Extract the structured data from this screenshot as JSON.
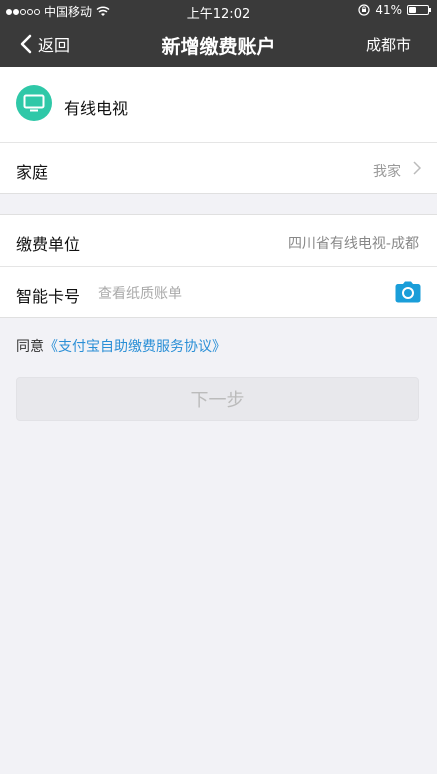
{
  "status_bar": {
    "carrier": "中国移动",
    "time": "上午12:02",
    "battery": "41%",
    "battery_level": 0.41
  },
  "nav": {
    "back_label": "返回",
    "title": "新增缴费账户",
    "city": "成都市"
  },
  "account": {
    "name": "有线电视",
    "icon": "tv-icon",
    "icon_color": "#2fc8a8"
  },
  "family": {
    "label": "家庭",
    "value": "我家"
  },
  "unit": {
    "label": "缴费单位",
    "value": "四川省有线电视-成都"
  },
  "card": {
    "label": "智能卡号",
    "placeholder": "查看纸质账单",
    "value": ""
  },
  "agreement": {
    "prefix": "同意",
    "link": "《支付宝自助缴费服务协议》",
    "link_color": "#2a8fd6"
  },
  "next_button": {
    "label": "下一步"
  }
}
